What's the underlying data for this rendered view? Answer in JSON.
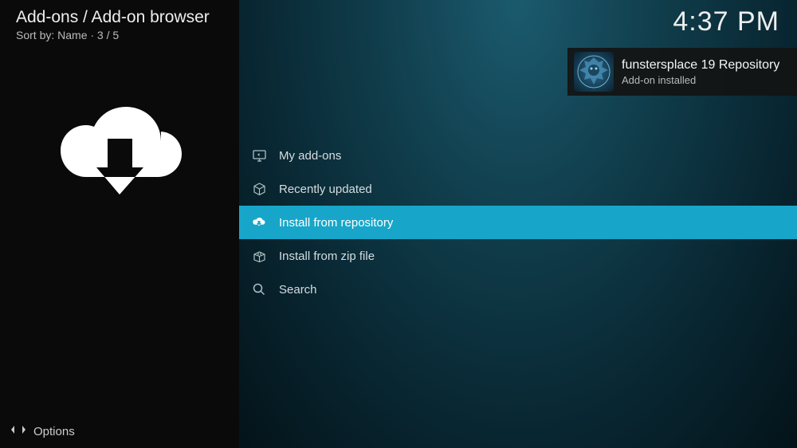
{
  "header": {
    "breadcrumb": "Add-ons / Add-on browser",
    "sort_line": "Sort by: Name  ·  3 / 5"
  },
  "clock": "4:37 PM",
  "toast": {
    "title": "funstersplace 19 Repository",
    "subtitle": "Add-on installed",
    "icon": "repo-icon"
  },
  "menu": {
    "items": [
      {
        "id": "my-addons",
        "label": "My add-ons",
        "icon": "monitor-icon",
        "selected": false
      },
      {
        "id": "recently-updated",
        "label": "Recently updated",
        "icon": "box-icon",
        "selected": false
      },
      {
        "id": "install-repo",
        "label": "Install from repository",
        "icon": "cloud-download-icon",
        "selected": true
      },
      {
        "id": "install-zip",
        "label": "Install from zip file",
        "icon": "box-open-icon",
        "selected": false
      },
      {
        "id": "search",
        "label": "Search",
        "icon": "search-icon",
        "selected": false
      }
    ]
  },
  "footer": {
    "options_label": "Options"
  }
}
